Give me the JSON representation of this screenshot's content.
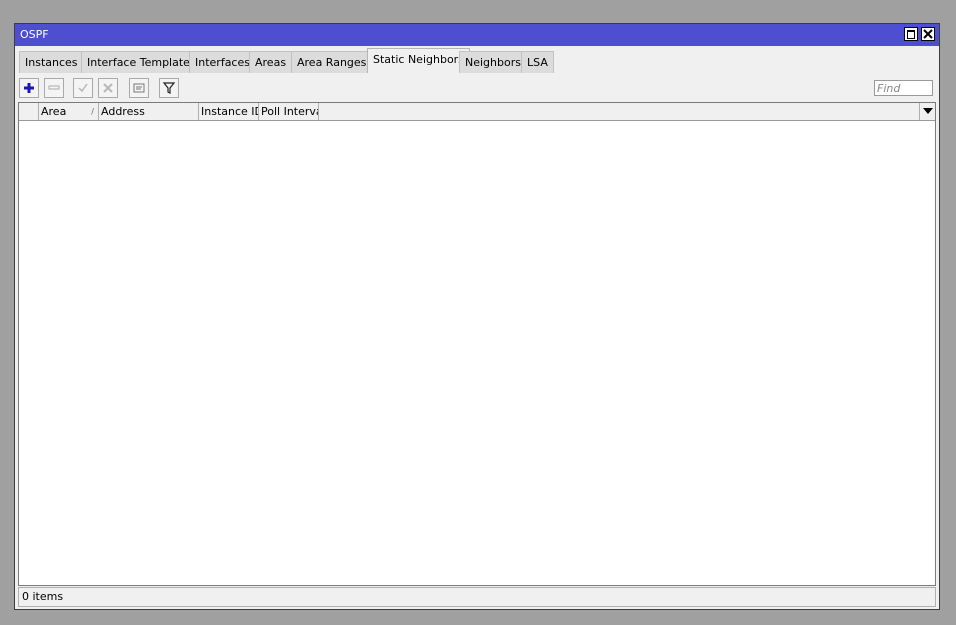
{
  "window": {
    "title": "OSPF"
  },
  "tabs": [
    {
      "label": "Instances"
    },
    {
      "label": "Interface Templates"
    },
    {
      "label": "Interfaces"
    },
    {
      "label": "Areas"
    },
    {
      "label": "Area Ranges"
    },
    {
      "label": "Static Neighbors",
      "active": true
    },
    {
      "label": "Neighbors"
    },
    {
      "label": "LSA"
    }
  ],
  "toolbar": {
    "buttons": [
      "add-icon",
      "remove-icon",
      "enable-icon",
      "disable-icon",
      "comment-icon",
      "filter-icon"
    ],
    "find_placeholder": "Find"
  },
  "table": {
    "columns": [
      {
        "label": ""
      },
      {
        "label": "Area",
        "sorted": true
      },
      {
        "label": "Address"
      },
      {
        "label": "Instance ID"
      },
      {
        "label": "Poll Interval"
      }
    ],
    "rows": []
  },
  "status": {
    "text": "0 items"
  },
  "colors": {
    "titlebar": "#4e4ed0",
    "background": "#a0a0a0",
    "panel": "#f0f0f0",
    "add_icon": "#1a1ab0"
  }
}
